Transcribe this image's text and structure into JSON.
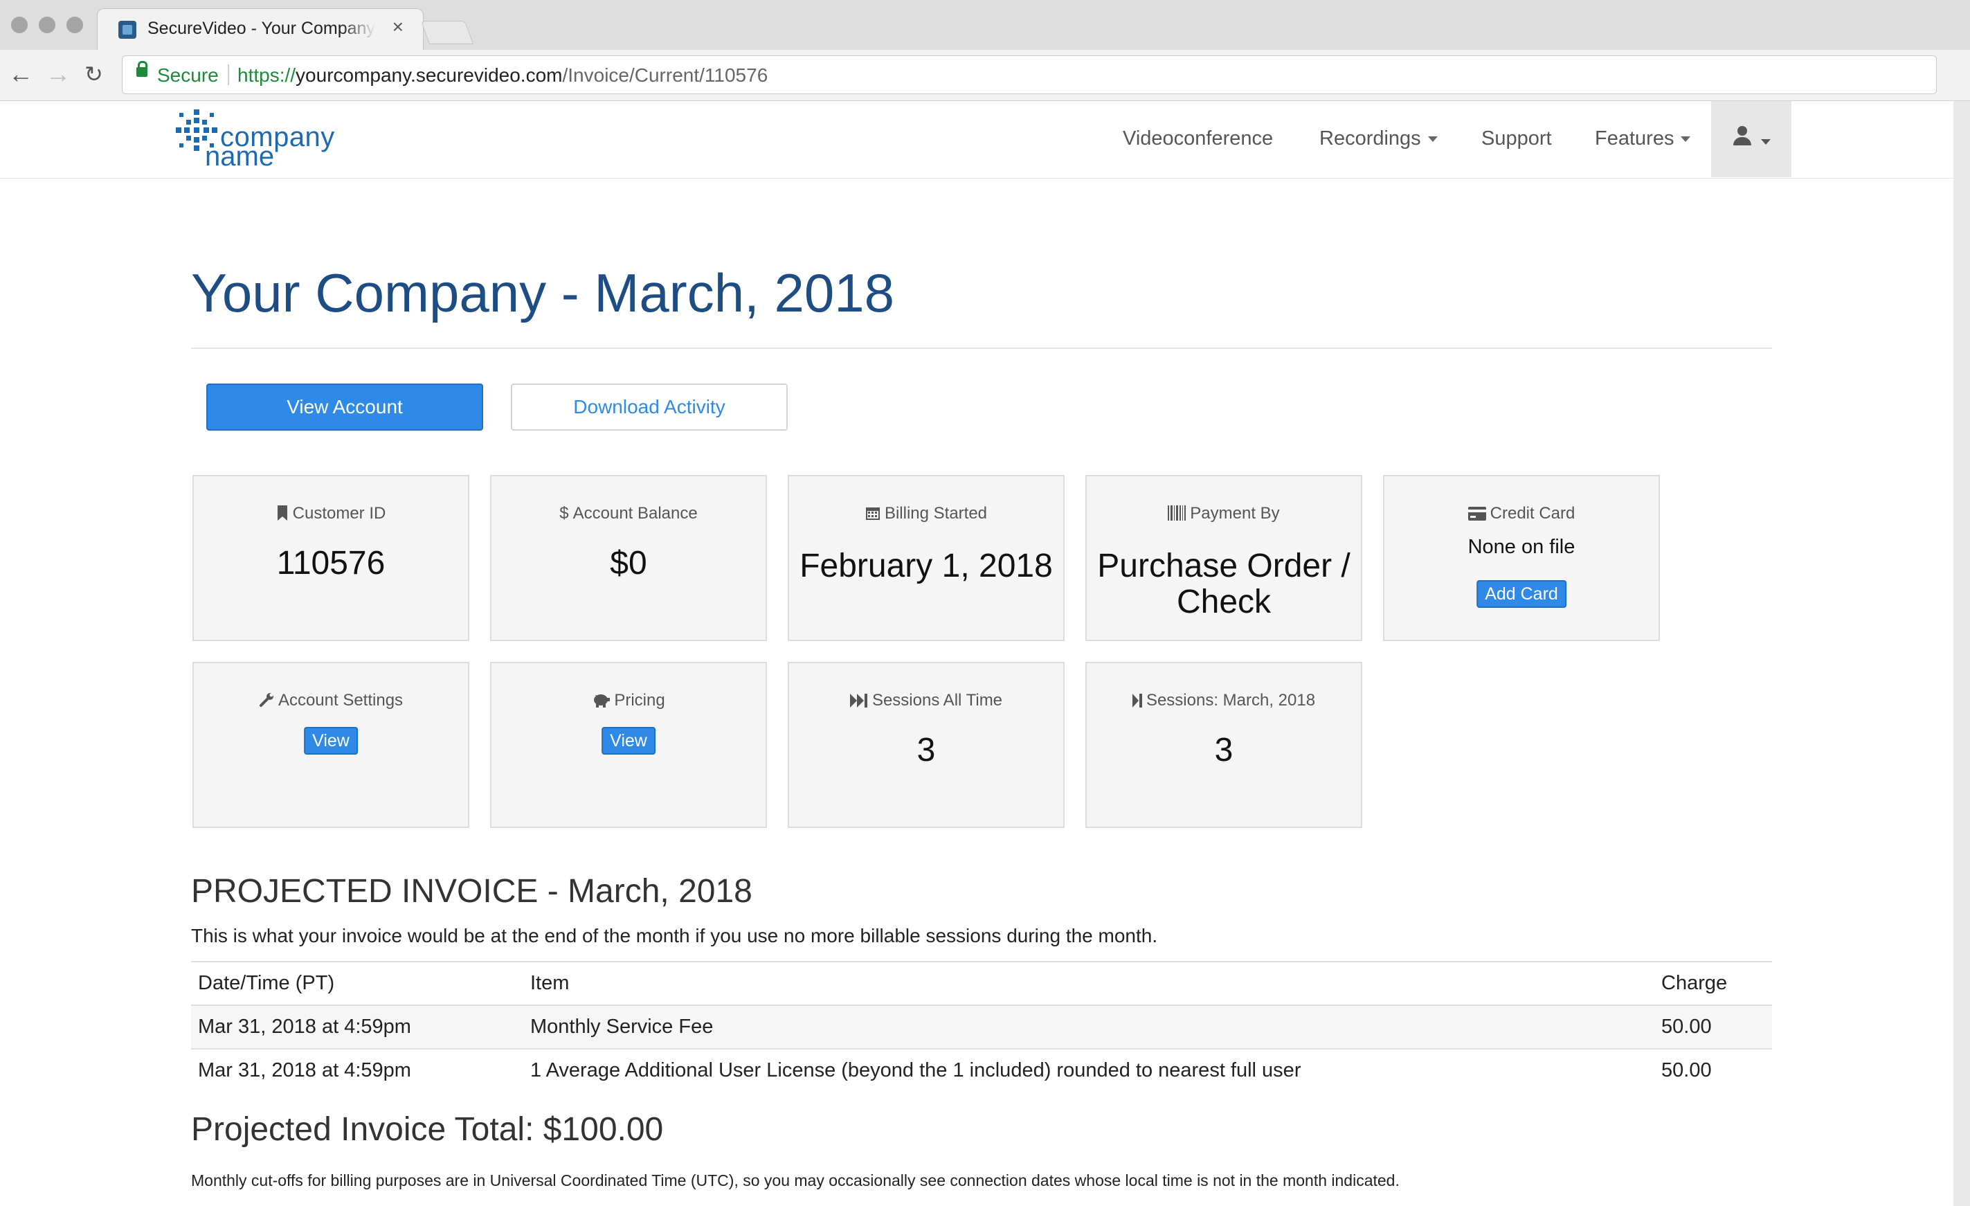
{
  "browser": {
    "tab_title": "SecureVideo - Your Company",
    "tab_close": "×",
    "secure_label": "Secure",
    "url_scheme": "https://",
    "url_host": "yourcompany.securevideo.com",
    "url_path": "/Invoice/Current/110576"
  },
  "header": {
    "logo_line1": "company",
    "logo_line2": "name",
    "nav": {
      "videoconference": "Videoconference",
      "recordings": "Recordings",
      "support": "Support",
      "features": "Features"
    }
  },
  "main": {
    "title": "Your Company - March, 2018",
    "view_account": "View Account",
    "download_activity": "Download Activity"
  },
  "cards": {
    "customer_id": {
      "label": "Customer ID",
      "value": "110576"
    },
    "account_balance": {
      "label": "Account Balance",
      "value": "$0"
    },
    "billing_started": {
      "label": "Billing Started",
      "value": "February 1, 2018"
    },
    "payment_by": {
      "label": "Payment By",
      "value": "Purchase Order / Check"
    },
    "credit_card": {
      "label": "Credit Card",
      "value": "None on file",
      "button": "Add Card"
    },
    "account_settings": {
      "label": "Account Settings",
      "button": "View"
    },
    "pricing": {
      "label": "Pricing",
      "button": "View"
    },
    "sessions_all_time": {
      "label": "Sessions All Time",
      "value": "3"
    },
    "sessions_month": {
      "label": "Sessions: March, 2018",
      "value": "3"
    }
  },
  "invoice": {
    "title": "PROJECTED INVOICE - March, 2018",
    "description": "This is what your invoice would be at the end of the month if you use no more billable sessions during the month.",
    "columns": [
      "Date/Time (PT)",
      "Item",
      "Charge"
    ],
    "rows": [
      [
        "Mar 31, 2018 at 4:59pm",
        "Monthly Service Fee",
        "50.00"
      ],
      [
        "Mar 31, 2018 at 4:59pm",
        "1 Average Additional User License (beyond the 1 included) rounded to nearest full user",
        "50.00"
      ]
    ],
    "total": "Projected Invoice Total: $100.00",
    "footnote": "Monthly cut-offs for billing purposes are in Universal Coordinated Time (UTC), so you may occasionally see connection dates whose local time is not in the month indicated."
  },
  "colors": {
    "title_blue": "#1e4d84",
    "primary_button": "#2e8ae6",
    "secure_green": "#1e8a3a"
  },
  "icons": {
    "customer_id": "bookmark-icon",
    "account_balance": "dollar-icon",
    "billing_started": "calendar-icon",
    "payment_by": "barcode-icon",
    "credit_card": "credit-card-icon",
    "account_settings": "wrench-icon",
    "pricing": "piggy-bank-icon",
    "sessions_all_time": "fast-forward-icon",
    "sessions_month": "step-forward-icon",
    "user_menu": "user-icon"
  }
}
